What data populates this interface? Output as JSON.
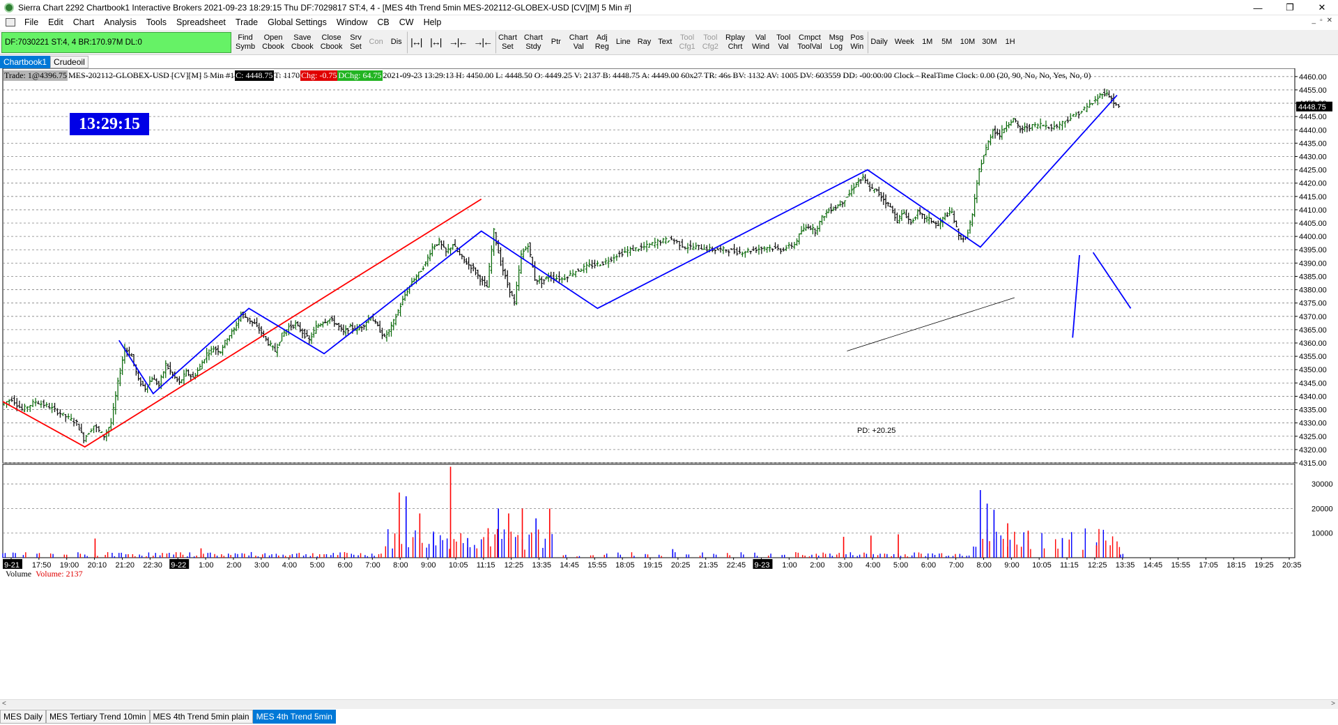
{
  "window": {
    "title": "Sierra Chart 2292 Chartbook1  Interactive Brokers 2021-09-23  18:29:15 Thu  DF:7029817  ST:4, 4 - [MES 4th Trend 5min MES-202112-GLOBEX-USD [CV][M]  5 Min  #]",
    "minimize": "—",
    "restore": "❐",
    "close": "✕"
  },
  "menu": {
    "items": [
      "File",
      "Edit",
      "Chart",
      "Analysis",
      "Tools",
      "Spreadsheet",
      "Trade",
      "Global Settings",
      "Window",
      "CB",
      "CW",
      "Help"
    ],
    "mdi_controls": [
      "_",
      "▫",
      "✕"
    ]
  },
  "toolbar": {
    "df_status": "DF:7030221  ST:4, 4  BR:170.97M  DL:0",
    "buttons": [
      {
        "label": "Find Symb",
        "enabled": true
      },
      {
        "label": "Open Cbook",
        "enabled": true
      },
      {
        "label": "Save Cbook",
        "enabled": true
      },
      {
        "label": "Close Cbook",
        "enabled": true
      },
      {
        "label": "Srv Set",
        "enabled": true
      },
      {
        "label": "Con",
        "enabled": false
      },
      {
        "label": "Dis",
        "enabled": true
      },
      {
        "label": "|↔|",
        "enabled": true,
        "icon": true
      },
      {
        "label": "|↔|",
        "enabled": true,
        "icon": true
      },
      {
        "label": "→|←",
        "enabled": true,
        "icon": true
      },
      {
        "label": "→|←",
        "enabled": true,
        "icon": true
      },
      {
        "label": "Chart Set",
        "enabled": true
      },
      {
        "label": "Chart Stdy",
        "enabled": true
      },
      {
        "label": "Ptr",
        "enabled": true
      },
      {
        "label": "Chart Val",
        "enabled": true
      },
      {
        "label": "Adj Reg",
        "enabled": true
      },
      {
        "label": "Line",
        "enabled": true
      },
      {
        "label": "Ray",
        "enabled": true
      },
      {
        "label": "Text",
        "enabled": true
      },
      {
        "label": "Tool Cfg1",
        "enabled": false
      },
      {
        "label": "Tool Cfg2",
        "enabled": false
      },
      {
        "label": "Rplay Chrt",
        "enabled": true
      },
      {
        "label": "Val Wind",
        "enabled": true
      },
      {
        "label": "Tool Val",
        "enabled": true
      },
      {
        "label": "Cmpct ToolVal",
        "enabled": true
      },
      {
        "label": "Msg Log",
        "enabled": true
      },
      {
        "label": "Pos Win",
        "enabled": true
      },
      {
        "label": "Daily",
        "enabled": true
      },
      {
        "label": "Week",
        "enabled": true
      },
      {
        "label": "1M",
        "enabled": true
      },
      {
        "label": "5M",
        "enabled": true
      },
      {
        "label": "10M",
        "enabled": true
      },
      {
        "label": "30M",
        "enabled": true
      },
      {
        "label": "1H",
        "enabled": true
      }
    ]
  },
  "chartbook_tabs": [
    {
      "label": "Chartbook1",
      "active": true
    },
    {
      "label": "Crudeoil",
      "active": false
    }
  ],
  "info_line": {
    "trade": "Trade: 1@4396.75",
    "symbol": "MES-202112-GLOBEX-USD [CV][M]  5 Min  #1",
    "close": "C: 4448.75",
    "ticks": "T: 1170",
    "chg": "Chg: -0.75",
    "dchg": "DChg: 64.75",
    "rest": "2021-09-23 13:29:13 H: 4450.00 L: 4448.50 O: 4449.25 V: 2137 B: 4448.75 A: 4449.00 60x27 TR: 46s BV: 1132 AV: 1005 DV: 603559 DD: -00:00:00 Clock - RealTime  Clock: 0.00   (20, 90, No, No, Yes, No, 0)"
  },
  "clock": "13:29:15",
  "price_marker": "4448.75",
  "pd_label": "PD: +20.25",
  "volume_panel": {
    "title": "Volume",
    "value": "Volume: 2137"
  },
  "chart_data": {
    "type": "bar",
    "price_axis": {
      "ylim": [
        4315,
        4461
      ],
      "ticks": [
        4315,
        4320,
        4325,
        4330,
        4335,
        4340,
        4345,
        4350,
        4355,
        4360,
        4365,
        4370,
        4375,
        4380,
        4385,
        4390,
        4395,
        4400,
        4405,
        4410,
        4415,
        4420,
        4425,
        4430,
        4435,
        4440,
        4445,
        4450,
        4455,
        4460
      ],
      "tick_labels": [
        "4315.00",
        "4320.00",
        "4325.00",
        "4330.00",
        "4335.00",
        "4340.00",
        "4345.00",
        "4350.00",
        "4355.00",
        "4360.00",
        "4365.00",
        "4370.00",
        "4375.00",
        "4380.00",
        "4385.00",
        "4390.00",
        "4395.00",
        "4400.00",
        "4405.00",
        "4410.00",
        "4415.00",
        "4420.00",
        "4425.00",
        "4430.00",
        "4435.00",
        "4440.00",
        "4445.00",
        "4450.00",
        "4455.00",
        "4460.00"
      ]
    },
    "volume_axis": {
      "ylim": [
        0,
        38000
      ],
      "ticks": [
        10000,
        20000,
        30000
      ],
      "tick_labels": [
        "10000",
        "20000",
        "30000"
      ]
    },
    "time_axis": {
      "labels": [
        "9-21",
        "17:50",
        "19:00",
        "20:10",
        "21:20",
        "22:30",
        "9-22",
        "1:00",
        "2:00",
        "3:00",
        "4:00",
        "5:00",
        "6:00",
        "7:00",
        "8:00",
        "9:00",
        "10:05",
        "11:15",
        "12:25",
        "13:35",
        "14:45",
        "15:55",
        "18:05",
        "19:15",
        "20:25",
        "21:35",
        "22:45",
        "9-23",
        "1:00",
        "2:00",
        "3:00",
        "4:00",
        "5:00",
        "6:00",
        "7:00",
        "8:00",
        "9:00",
        "10:05",
        "11:15",
        "12:25",
        "13:35",
        "14:45",
        "15:55",
        "17:05",
        "18:15",
        "19:25",
        "20:35"
      ],
      "date_labels": [
        "9-21",
        "9-22",
        "9-23"
      ]
    },
    "price_path": [
      [
        0,
        4337
      ],
      [
        3,
        4339
      ],
      [
        6,
        4335
      ],
      [
        10,
        4338
      ],
      [
        14,
        4336
      ],
      [
        18,
        4333
      ],
      [
        22,
        4330
      ],
      [
        24,
        4324
      ],
      [
        27,
        4329
      ],
      [
        30,
        4325
      ],
      [
        32,
        4330
      ],
      [
        34,
        4345
      ],
      [
        36,
        4358
      ],
      [
        38,
        4355
      ],
      [
        40,
        4346
      ],
      [
        42,
        4343
      ],
      [
        44,
        4347
      ],
      [
        46,
        4344
      ],
      [
        48,
        4352
      ],
      [
        50,
        4348
      ],
      [
        52,
        4345
      ],
      [
        54,
        4349
      ],
      [
        56,
        4347
      ],
      [
        58,
        4351
      ],
      [
        60,
        4356
      ],
      [
        62,
        4358
      ],
      [
        64,
        4357
      ],
      [
        66,
        4362
      ],
      [
        68,
        4365
      ],
      [
        70,
        4371
      ],
      [
        72,
        4369
      ],
      [
        74,
        4367
      ],
      [
        76,
        4364
      ],
      [
        78,
        4360
      ],
      [
        80,
        4357
      ],
      [
        82,
        4363
      ],
      [
        84,
        4366
      ],
      [
        86,
        4367
      ],
      [
        88,
        4364
      ],
      [
        90,
        4361
      ],
      [
        92,
        4366
      ],
      [
        94,
        4368
      ],
      [
        96,
        4369
      ],
      [
        98,
        4367
      ],
      [
        100,
        4364
      ],
      [
        102,
        4366
      ],
      [
        104,
        4365
      ],
      [
        106,
        4367
      ],
      [
        108,
        4370
      ],
      [
        110,
        4366
      ],
      [
        112,
        4362
      ],
      [
        114,
        4366
      ],
      [
        116,
        4372
      ],
      [
        118,
        4378
      ],
      [
        120,
        4383
      ],
      [
        122,
        4386
      ],
      [
        124,
        4390
      ],
      [
        126,
        4396
      ],
      [
        128,
        4398
      ],
      [
        130,
        4394
      ],
      [
        132,
        4397
      ],
      [
        134,
        4393
      ],
      [
        136,
        4390
      ],
      [
        138,
        4388
      ],
      [
        140,
        4384
      ],
      [
        142,
        4381
      ],
      [
        144,
        4402
      ],
      [
        146,
        4390
      ],
      [
        148,
        4382
      ],
      [
        150,
        4375
      ],
      [
        152,
        4393
      ],
      [
        154,
        4397
      ],
      [
        156,
        4384
      ],
      [
        158,
        4383
      ],
      [
        160,
        4385
      ],
      [
        164,
        4384
      ],
      [
        168,
        4387
      ],
      [
        172,
        4389
      ],
      [
        176,
        4390
      ],
      [
        180,
        4393
      ],
      [
        184,
        4395
      ],
      [
        188,
        4396
      ],
      [
        192,
        4398
      ],
      [
        196,
        4399
      ],
      [
        200,
        4396
      ],
      [
        204,
        4396
      ],
      [
        208,
        4395
      ],
      [
        212,
        4395
      ],
      [
        216,
        4394
      ],
      [
        220,
        4395
      ],
      [
        224,
        4396
      ],
      [
        228,
        4395
      ],
      [
        232,
        4397
      ],
      [
        234,
        4402
      ],
      [
        236,
        4404
      ],
      [
        238,
        4402
      ],
      [
        240,
        4407
      ],
      [
        242,
        4410
      ],
      [
        244,
        4411
      ],
      [
        246,
        4413
      ],
      [
        248,
        4416
      ],
      [
        250,
        4420
      ],
      [
        252,
        4422
      ],
      [
        254,
        4418
      ],
      [
        256,
        4417
      ],
      [
        258,
        4414
      ],
      [
        260,
        4411
      ],
      [
        262,
        4406
      ],
      [
        264,
        4409
      ],
      [
        266,
        4405
      ],
      [
        268,
        4409
      ],
      [
        270,
        4407
      ],
      [
        272,
        4406
      ],
      [
        274,
        4404
      ],
      [
        276,
        4408
      ],
      [
        278,
        4409
      ],
      [
        280,
        4400
      ],
      [
        282,
        4399
      ],
      [
        284,
        4408
      ],
      [
        286,
        4425
      ],
      [
        288,
        4433
      ],
      [
        290,
        4440
      ],
      [
        292,
        4438
      ],
      [
        294,
        4442
      ],
      [
        296,
        4444
      ],
      [
        298,
        4440
      ],
      [
        300,
        4441
      ],
      [
        304,
        4442
      ],
      [
        308,
        4441
      ],
      [
        312,
        4444
      ],
      [
        316,
        4447
      ],
      [
        320,
        4451
      ],
      [
        322,
        4454
      ],
      [
        324,
        4453
      ],
      [
        326,
        4449
      ],
      [
        327,
        4448.75
      ]
    ],
    "drawings": [
      {
        "color": "#ff0000",
        "points": [
          [
            0,
            4338
          ],
          [
            24,
            4321
          ],
          [
            140,
            4414
          ]
        ]
      },
      {
        "color": "#0000ff",
        "points": [
          [
            34,
            4361
          ],
          [
            44,
            4341
          ],
          [
            72,
            4373
          ],
          [
            94,
            4356
          ],
          [
            140,
            4402
          ],
          [
            174,
            4373
          ],
          [
            253,
            4425
          ],
          [
            286,
            4396
          ],
          [
            326,
            4453
          ]
        ]
      },
      {
        "color": "#0000ff",
        "points": [
          [
            315,
            4393
          ],
          [
            313,
            4362
          ]
        ]
      },
      {
        "color": "#0000ff",
        "points": [
          [
            319,
            4394
          ],
          [
            330,
            4373
          ]
        ]
      },
      {
        "color": "#000000",
        "points": [
          [
            247,
            4357
          ],
          [
            296,
            4377
          ]
        ]
      }
    ],
    "volume_bars": [
      {
        "x": 27,
        "v": 7800,
        "color": "red"
      },
      {
        "x": 58,
        "v": 3800,
        "color": "red"
      },
      {
        "x": 116,
        "v": 26500,
        "color": "red"
      },
      {
        "x": 118,
        "v": 25000,
        "color": "blue"
      },
      {
        "x": 122,
        "v": 18000,
        "color": "red"
      },
      {
        "x": 126,
        "v": 10000,
        "color": "blue"
      },
      {
        "x": 131,
        "v": 37000,
        "color": "red"
      },
      {
        "x": 136,
        "v": 8000,
        "color": "blue"
      },
      {
        "x": 142,
        "v": 12000,
        "color": "red"
      },
      {
        "x": 145,
        "v": 20000,
        "color": "blue"
      },
      {
        "x": 148,
        "v": 18000,
        "color": "red"
      },
      {
        "x": 152,
        "v": 20000,
        "color": "red"
      },
      {
        "x": 156,
        "v": 16000,
        "color": "blue"
      },
      {
        "x": 160,
        "v": 20000,
        "color": "red"
      },
      {
        "x": 196,
        "v": 3500,
        "color": "blue"
      },
      {
        "x": 246,
        "v": 8500,
        "color": "red"
      },
      {
        "x": 254,
        "v": 9000,
        "color": "red"
      },
      {
        "x": 262,
        "v": 9500,
        "color": "red"
      },
      {
        "x": 286,
        "v": 27500,
        "color": "blue"
      },
      {
        "x": 288,
        "v": 22000,
        "color": "blue"
      },
      {
        "x": 290,
        "v": 19500,
        "color": "blue"
      },
      {
        "x": 294,
        "v": 14000,
        "color": "red"
      },
      {
        "x": 300,
        "v": 11000,
        "color": "red"
      },
      {
        "x": 310,
        "v": 8000,
        "color": "blue"
      },
      {
        "x": 320,
        "v": 5000,
        "color": "red"
      }
    ],
    "x_range": [
      0,
      378
    ]
  },
  "bottom_tabs": [
    {
      "label": "MES Daily",
      "active": false
    },
    {
      "label": "MES Tertiary Trend 10min",
      "active": false
    },
    {
      "label": "MES 4th Trend 5min plain",
      "active": false
    },
    {
      "label": "MES 4th Trend 5min",
      "active": true
    }
  ],
  "colors": {
    "up_bar": "#006400",
    "down_bar": "#000000",
    "vol_up": "#0000ff",
    "vol_down": "#ff0000",
    "df_status_bg": "#66f266",
    "active_tab": "#0078d7",
    "clock_bg": "#0000e6"
  }
}
